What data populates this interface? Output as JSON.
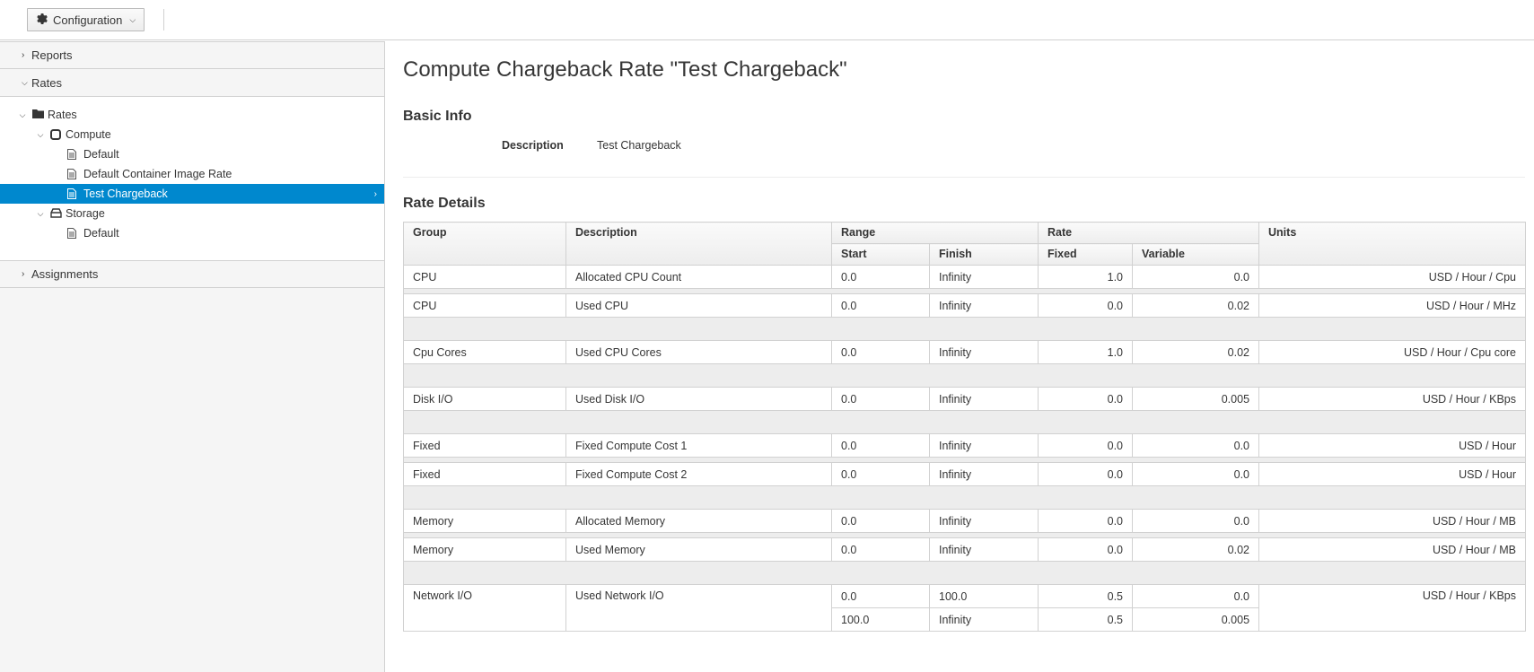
{
  "toolbar": {
    "config_label": "Configuration"
  },
  "sidebar": {
    "reports_label": "Reports",
    "rates_label": "Rates",
    "assignments_label": "Assignments",
    "tree": {
      "root": "Rates",
      "compute": "Compute",
      "compute_items": [
        "Default",
        "Default Container Image Rate",
        "Test Chargeback"
      ],
      "selected": "Test Chargeback",
      "storage": "Storage",
      "storage_items": [
        "Default"
      ]
    }
  },
  "main": {
    "title": "Compute Chargeback Rate \"Test Chargeback\"",
    "basic_info": {
      "heading": "Basic Info",
      "description_label": "Description",
      "description_value": "Test Chargeback"
    },
    "rate_details": {
      "heading": "Rate Details",
      "headers": {
        "group": "Group",
        "description": "Description",
        "range": "Range",
        "rate": "Rate",
        "units": "Units",
        "start": "Start",
        "finish": "Finish",
        "fixed": "Fixed",
        "variable": "Variable"
      },
      "rows": [
        {
          "group": "CPU",
          "description": "Allocated CPU Count",
          "start": "0.0",
          "finish": "Infinity",
          "fixed": "1.0",
          "variable": "0.0",
          "units": "USD / Hour / Cpu"
        },
        {
          "group": "CPU",
          "description": "Used CPU",
          "start": "0.0",
          "finish": "Infinity",
          "fixed": "0.0",
          "variable": "0.02",
          "units": "USD / Hour / MHz"
        },
        {
          "group": "Cpu Cores",
          "description": "Used CPU Cores",
          "start": "0.0",
          "finish": "Infinity",
          "fixed": "1.0",
          "variable": "0.02",
          "units": "USD / Hour / Cpu core"
        },
        {
          "group": "Disk I/O",
          "description": "Used Disk I/O",
          "start": "0.0",
          "finish": "Infinity",
          "fixed": "0.0",
          "variable": "0.005",
          "units": "USD / Hour / KBps"
        },
        {
          "group": "Fixed",
          "description": "Fixed Compute Cost 1",
          "start": "0.0",
          "finish": "Infinity",
          "fixed": "0.0",
          "variable": "0.0",
          "units": "USD / Hour"
        },
        {
          "group": "Fixed",
          "description": "Fixed Compute Cost 2",
          "start": "0.0",
          "finish": "Infinity",
          "fixed": "0.0",
          "variable": "0.0",
          "units": "USD / Hour"
        },
        {
          "group": "Memory",
          "description": "Allocated Memory",
          "start": "0.0",
          "finish": "Infinity",
          "fixed": "0.0",
          "variable": "0.0",
          "units": "USD / Hour / MB"
        },
        {
          "group": "Memory",
          "description": "Used Memory",
          "start": "0.0",
          "finish": "Infinity",
          "fixed": "0.0",
          "variable": "0.02",
          "units": "USD / Hour / MB"
        },
        {
          "group": "Network I/O",
          "description": "Used Network I/O",
          "start": "0.0",
          "finish": "100.0",
          "fixed": "0.5",
          "variable": "0.0",
          "units": "USD / Hour / KBps"
        },
        {
          "start": "100.0",
          "finish": "Infinity",
          "fixed": "0.5",
          "variable": "0.005"
        }
      ]
    }
  },
  "colors": {
    "selection_blue": "#0088ce",
    "border_gray": "#d1d1d1",
    "sidebar_bg": "#f5f5f5"
  }
}
